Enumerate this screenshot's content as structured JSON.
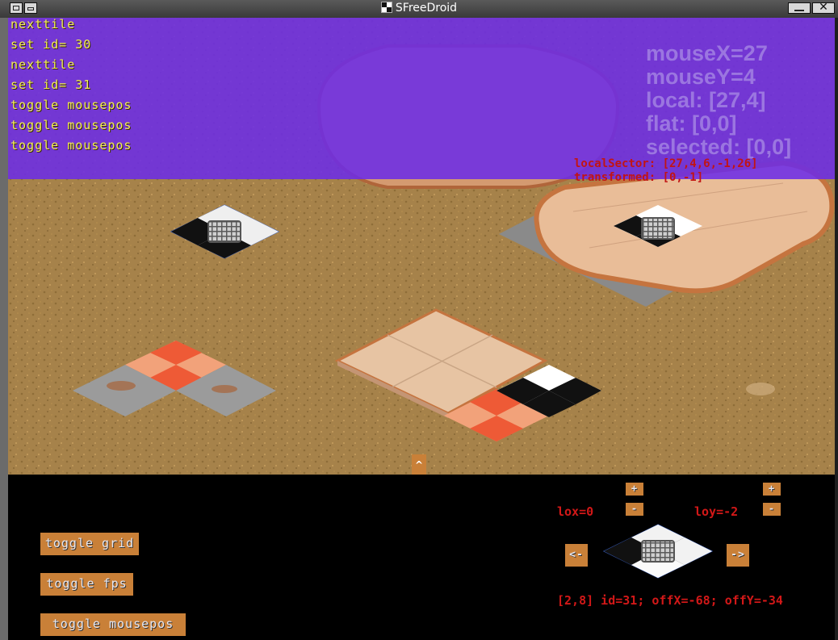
{
  "window": {
    "title": "SFreeDroid",
    "icons": [
      "app-icon",
      "window-menu-icon",
      "restore-icon",
      "minimize-icon",
      "close-icon"
    ]
  },
  "console": {
    "lines": [
      "nexttile",
      "set id= 30",
      "nexttile",
      "set id= 31",
      "toggle mousepos",
      "toggle mousepos",
      "toggle mousepos"
    ]
  },
  "mouse_info": {
    "mouseX": "mouseX=27",
    "mouseY": "mouseY=4",
    "local": "local: [27,4]",
    "flat": "flat: [0,0]",
    "selected": "selected: [0,0]"
  },
  "sector_info": {
    "local_sector": "localSector: [27,4,6,-1,26]",
    "transformed": "transformed: [0,-1]"
  },
  "panel": {
    "scroll_up_label": "^",
    "buttons": {
      "toggle_grid": "toggle grid",
      "toggle_fps": "toggle fps",
      "toggle_mousepos": "toggle mousepos"
    },
    "lox_label": "lox=0",
    "loy_label": "loy=-2",
    "plus": "+",
    "minus": "-",
    "prev_tile": "<-",
    "next_tile": "->",
    "tile_info": "[2,8] id=31; offX=-68; offY=-34"
  },
  "colors": {
    "console_bg": "#6c2ce6",
    "console_text": "#f2ee5a",
    "debug_red": "#c11414",
    "button_bg": "#c98038",
    "sand": "#a6824a"
  }
}
